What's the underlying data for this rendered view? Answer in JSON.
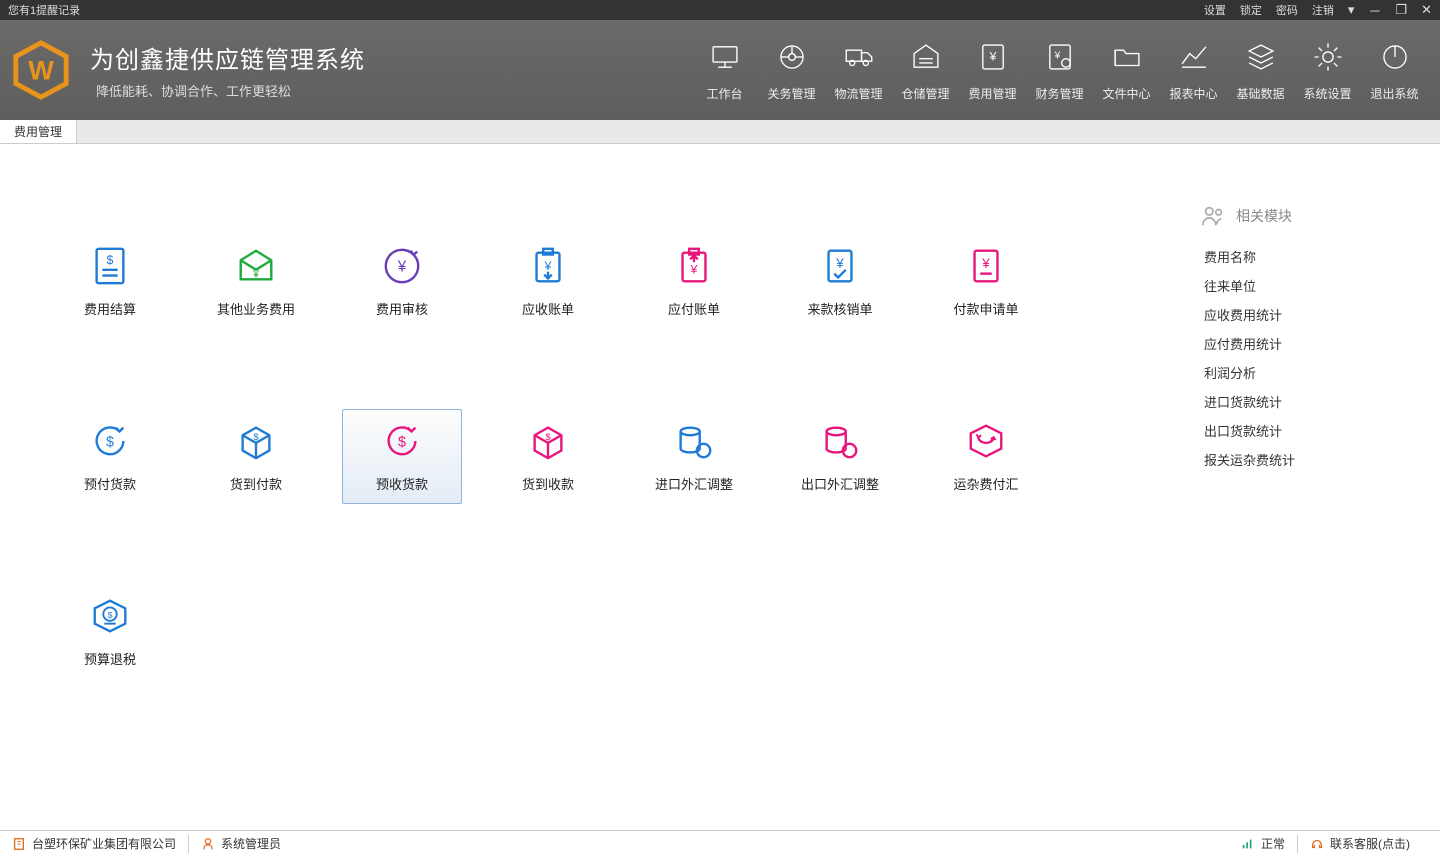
{
  "titlebar": {
    "reminder": "您有1提醒记录",
    "settings": "设置",
    "lock": "锁定",
    "password": "密码",
    "logout": "注销"
  },
  "brand": {
    "title": "为创鑫捷供应链管理系统",
    "subtitle": "降低能耗、协调合作、工作更轻松"
  },
  "nav": {
    "workbench": "工作台",
    "customs": "关务管理",
    "logistics": "物流管理",
    "warehouse": "仓储管理",
    "expense": "费用管理",
    "finance": "财务管理",
    "files": "文件中心",
    "report": "报表中心",
    "basedata": "基础数据",
    "syssettings": "系统设置",
    "exit": "退出系统"
  },
  "tab": {
    "active": "费用管理"
  },
  "modules": {
    "settlement": "费用结算",
    "other_biz": "其他业务费用",
    "audit": "费用审核",
    "receivable": "应收账单",
    "payable": "应付账单",
    "incoming_verify": "来款核销单",
    "payment_request": "付款申请单",
    "prepay_goods": "预付货款",
    "cod_pay": "货到付款",
    "prereceive_goods": "预收货款",
    "cod_receive": "货到收款",
    "import_fx": "进口外汇调整",
    "export_fx": "出口外汇调整",
    "freight_pay": "运杂费付汇",
    "prebudget_refund": "预算退税"
  },
  "sidepanel": {
    "title": "相关模块",
    "links": {
      "fee_name": "费用名称",
      "partner": "往来单位",
      "recv_stat": "应收费用统计",
      "pay_stat": "应付费用统计",
      "profit": "利润分析",
      "import_goods_stat": "进口货款统计",
      "export_goods_stat": "出口货款统计",
      "customs_fee_stat": "报关运杂费统计"
    }
  },
  "status": {
    "company": "台塑环保矿业集团有限公司",
    "user": "系统管理员",
    "state": "正常",
    "contact": "联系客服(点击)"
  }
}
